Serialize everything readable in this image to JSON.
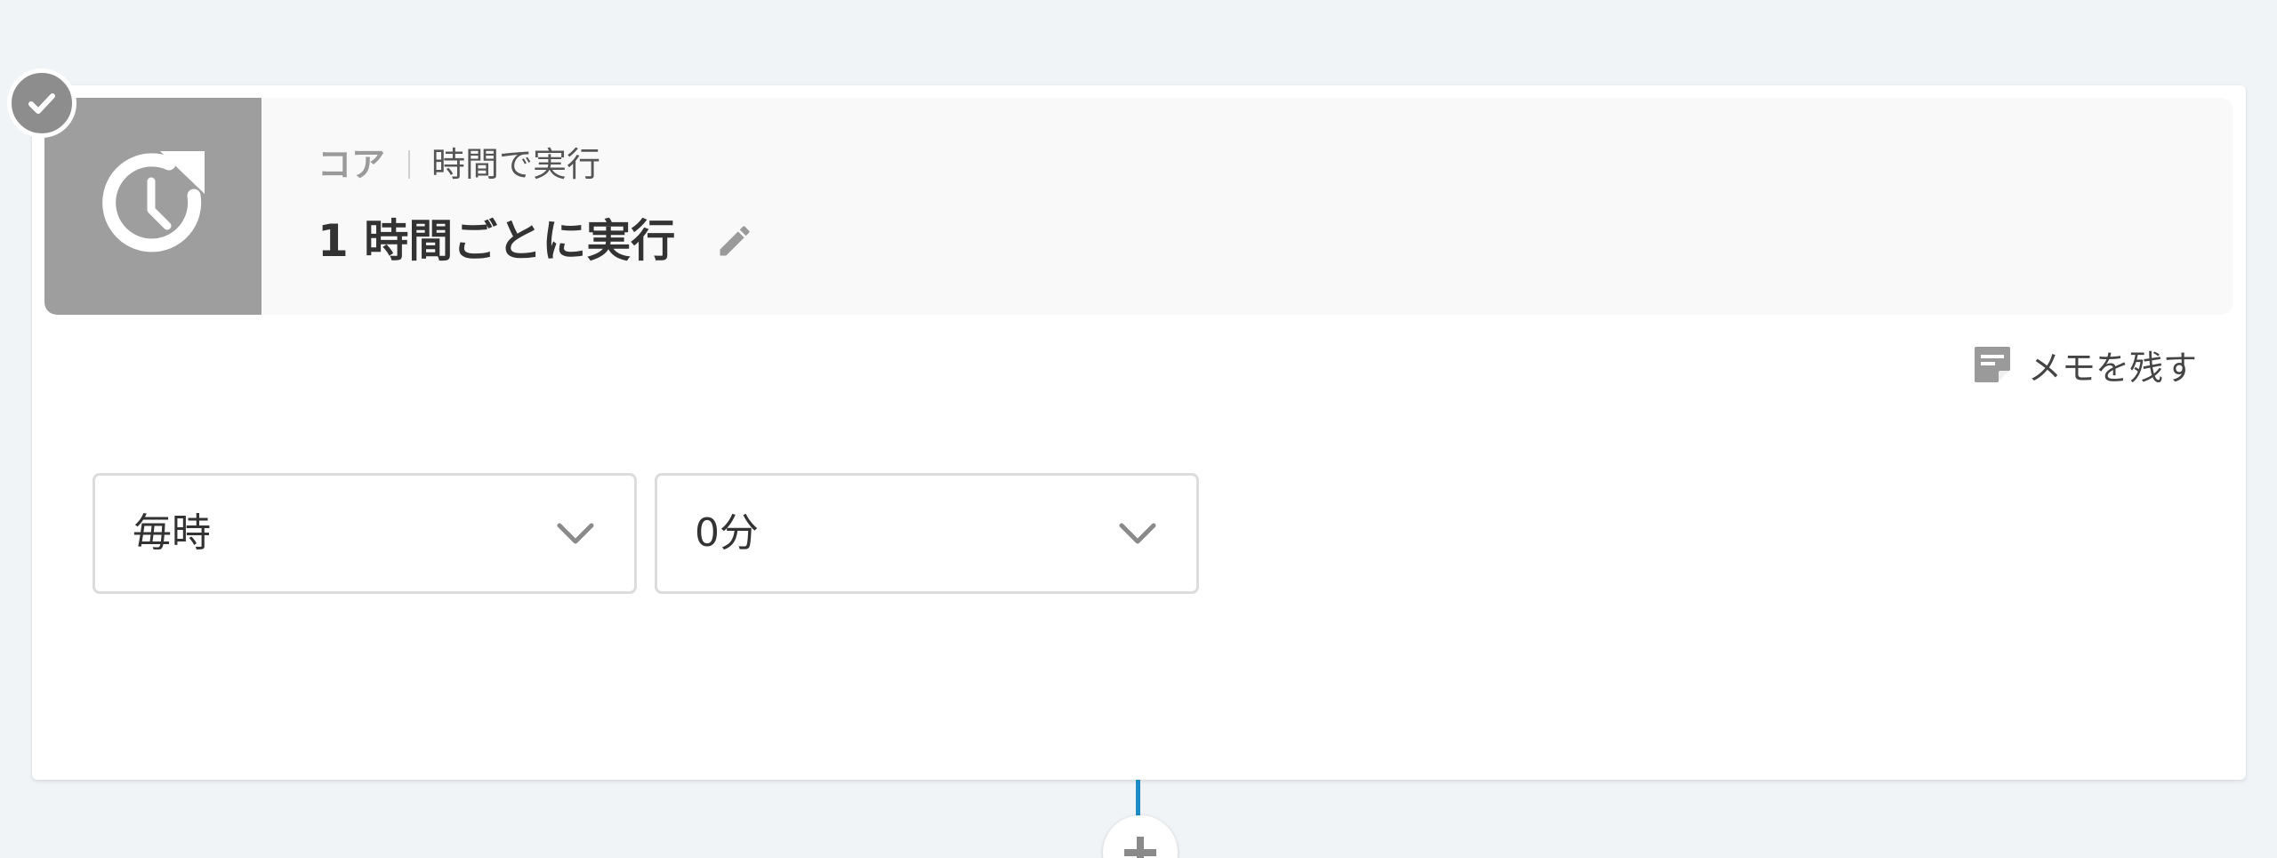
{
  "step": {
    "category": "コア",
    "subtitle": "時間で実行",
    "title": "1 時間ごとに実行",
    "status": "completed"
  },
  "memo": {
    "label": "メモを残す"
  },
  "schedule": {
    "frequency": {
      "selected": "毎時"
    },
    "minute": {
      "selected": "0分"
    }
  },
  "icons": {
    "step": "clock-refresh-icon",
    "status": "check-icon",
    "edit": "pencil-icon",
    "memo": "note-icon",
    "dropdown": "chevron-down-icon",
    "add": "plus-icon"
  },
  "colors": {
    "background": "#f1f4f7",
    "card": "#ffffff",
    "header": "#f9f9f9",
    "icon_tile": "#9e9e9e",
    "badge": "#8d8d8d",
    "connector": "#1d8bc6"
  }
}
